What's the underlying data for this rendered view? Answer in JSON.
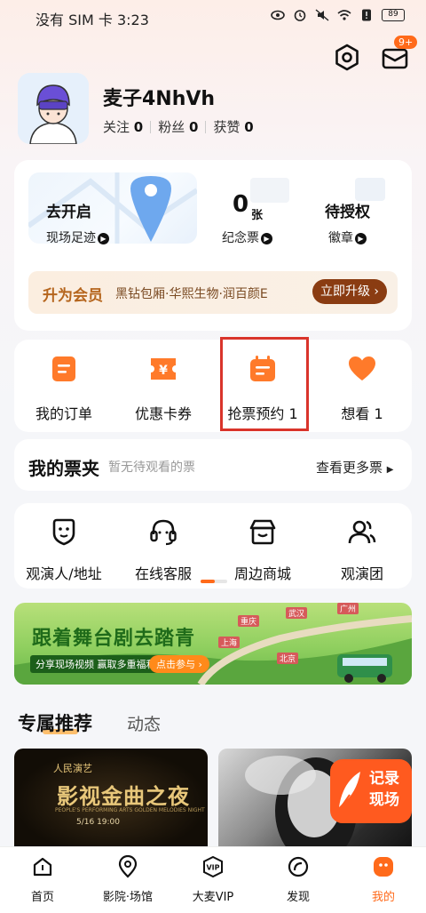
{
  "status_bar": {
    "left_text": "没有 SIM 卡 3:23",
    "battery": "89"
  },
  "header": {
    "message_badge": "9+"
  },
  "profile": {
    "username": "麦子4NhVh",
    "follow_label": "关注",
    "follow_count": "0",
    "fans_label": "粉丝",
    "fans_count": "0",
    "likes_label": "获赞",
    "likes_count": "0"
  },
  "summary": {
    "footprint_title": "去开启",
    "footprint_sub": "现场足迹",
    "ticket_count": "0",
    "ticket_unit": "张",
    "ticket_sub": "纪念票",
    "badge_title": "待授权",
    "badge_sub": "徽章"
  },
  "member": {
    "title": "升为会员",
    "desc": "黑钻包厢·华熙生物·润百颜E",
    "cta": "立即升级"
  },
  "quick_actions": [
    {
      "label": "我的订单",
      "icon": "order-icon"
    },
    {
      "label": "优惠卡券",
      "icon": "coupon-icon"
    },
    {
      "label": "抢票预约 1",
      "icon": "calendar-icon"
    },
    {
      "label": "想看 1",
      "icon": "heart-icon"
    }
  ],
  "wallet": {
    "title": "我的票夹",
    "empty_text": "暂无待观看的票",
    "more": "查看更多票"
  },
  "services": [
    {
      "label": "观演人/地址",
      "icon": "viewer-icon"
    },
    {
      "label": "在线客服",
      "icon": "headset-icon"
    },
    {
      "label": "周边商城",
      "icon": "shop-icon"
    },
    {
      "label": "观演团",
      "icon": "group-icon"
    }
  ],
  "banner": {
    "title": "跟着舞台剧去踏青",
    "sub": "分享现场视频  赢取多重福利",
    "cta": "点击参与",
    "cities": [
      "重庆",
      "武汉",
      "广州",
      "上海",
      "北京"
    ]
  },
  "tabs": {
    "active": "专属推荐",
    "inactive": "动态"
  },
  "posters": {
    "p1_top": "人民演艺",
    "p1_title": "影视金曲之夜",
    "p1_eng": "PEOPLE'S PERFORMING ARTS GOLDEN MELODIES NIGHT",
    "p1_date": "5/16 19:00",
    "record_text": "记录现场"
  },
  "bottom_nav": [
    {
      "label": "首页",
      "icon": "home-icon"
    },
    {
      "label": "影院·场馆",
      "icon": "location-icon"
    },
    {
      "label": "大麦VIP",
      "icon": "vip-icon"
    },
    {
      "label": "发现",
      "icon": "discover-icon"
    },
    {
      "label": "我的",
      "icon": "mine-icon"
    }
  ],
  "colors": {
    "accent": "#ff6a1a",
    "highlight_box": "#d9342b",
    "member_btn": "#8a3c12"
  }
}
